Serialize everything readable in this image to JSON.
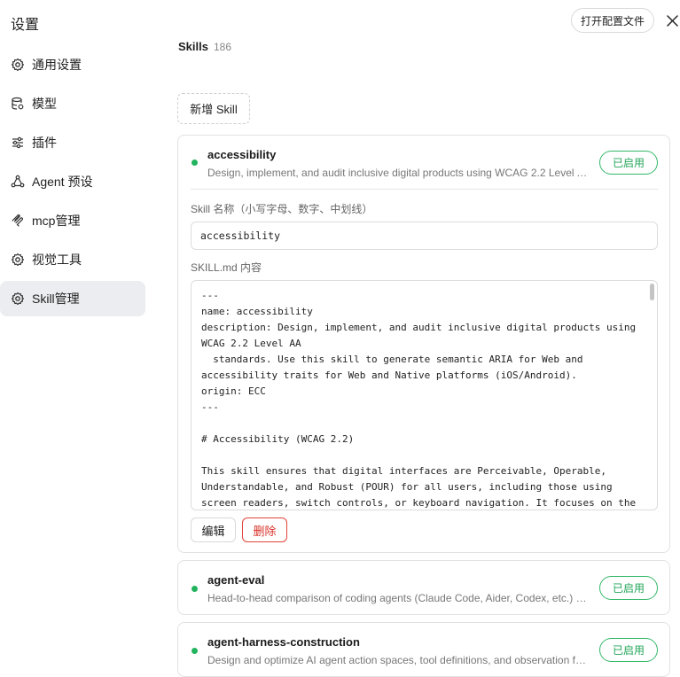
{
  "sidebar": {
    "title": "设置",
    "items": [
      {
        "label": "通用设置",
        "icon": "gear-icon"
      },
      {
        "label": "模型",
        "icon": "database-icon"
      },
      {
        "label": "插件",
        "icon": "sliders-icon"
      },
      {
        "label": "Agent 预设",
        "icon": "agent-icon"
      },
      {
        "label": "mcp管理",
        "icon": "mcp-icon"
      },
      {
        "label": "视觉工具",
        "icon": "gear-icon"
      },
      {
        "label": "Skill管理",
        "icon": "gear-icon",
        "active": true
      }
    ]
  },
  "header": {
    "open_config_label": "打开配置文件",
    "close_icon": "close-icon"
  },
  "skills": {
    "label": "Skills",
    "count": "186",
    "new_button_label": "新增 Skill",
    "enabled_label": "已启用",
    "status_color": "#22b35e",
    "items": [
      {
        "name": "accessibility",
        "description": "Design, implement, and audit inclusive digital products using WCAG 2.2 Level AA standards. Use this skill to generate semantic ARIA for Web and accessibility traits for Web and Native platforms (iOS/Android)."
      },
      {
        "name": "agent-eval",
        "description": "Head-to-head comparison of coding agents (Claude Code, Aider, Codex, etc.) on custom tasks with pass rate, cost, time, and consistency metrics"
      },
      {
        "name": "agent-harness-construction",
        "description": "Design and optimize AI agent action spaces, tool definitions, and observation formatting for higher completion rates."
      }
    ]
  },
  "editor": {
    "name_field_label": "Skill 名称（小写字母、数字、中划线）",
    "name_value": "accessibility",
    "content_field_label": "SKILL.md 内容",
    "content_lines": [
      "---",
      "name: accessibility",
      "description: Design, implement, and audit inclusive digital products using",
      "WCAG 2.2 Level AA",
      "  standards. Use this skill to generate semantic ARIA for Web and",
      "accessibility traits for Web and Native platforms (iOS/Android).",
      "origin: ECC",
      "---",
      "",
      "# Accessibility (WCAG 2.2)",
      "",
      "This skill ensures that digital interfaces are Perceivable, Operable,",
      "Understandable, and Robust (POUR) for all users, including those using",
      "screen readers, switch controls, or keyboard navigation. It focuses on the"
    ],
    "edit_label": "编辑",
    "delete_label": "删除"
  }
}
